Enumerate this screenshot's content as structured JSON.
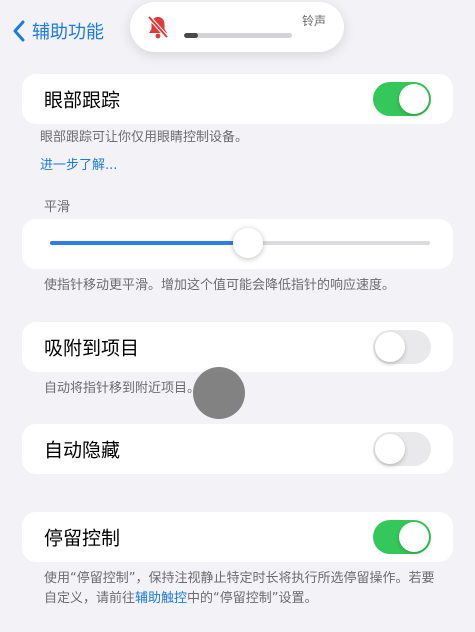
{
  "nav": {
    "back_label": "辅助功能"
  },
  "volume_hud": {
    "label": "铃声",
    "level": 0.13
  },
  "eye_tracking": {
    "label": "眼部跟踪",
    "enabled": true,
    "description": "眼部跟踪可让你仅用眼睛控制设备。",
    "learn_more": "进一步了解..."
  },
  "smoothing": {
    "section_title": "平滑",
    "value": 0.52,
    "description": "使指针移动更平滑。增加这个值可能会降低指针的响应速度。"
  },
  "snap_to_item": {
    "label": "吸附到项目",
    "enabled": false,
    "description": "自动将指针移到附近项目。"
  },
  "auto_hide": {
    "label": "自动隐藏",
    "enabled": false
  },
  "dwell_control": {
    "label": "停留控制",
    "enabled": true,
    "description_part1": "使用“停留控制”，保持注视静止特定时长将执行所选停留操作。若要自定义，请前往",
    "description_link": "辅助触控",
    "description_part2": "中的“停留控制”设置。"
  },
  "colors": {
    "accent": "#1f7ae0",
    "toggle_on": "#34c759",
    "toggle_off": "#e9e9eb",
    "background": "#f2f2f7",
    "muted_bell": "#e03a3a"
  }
}
